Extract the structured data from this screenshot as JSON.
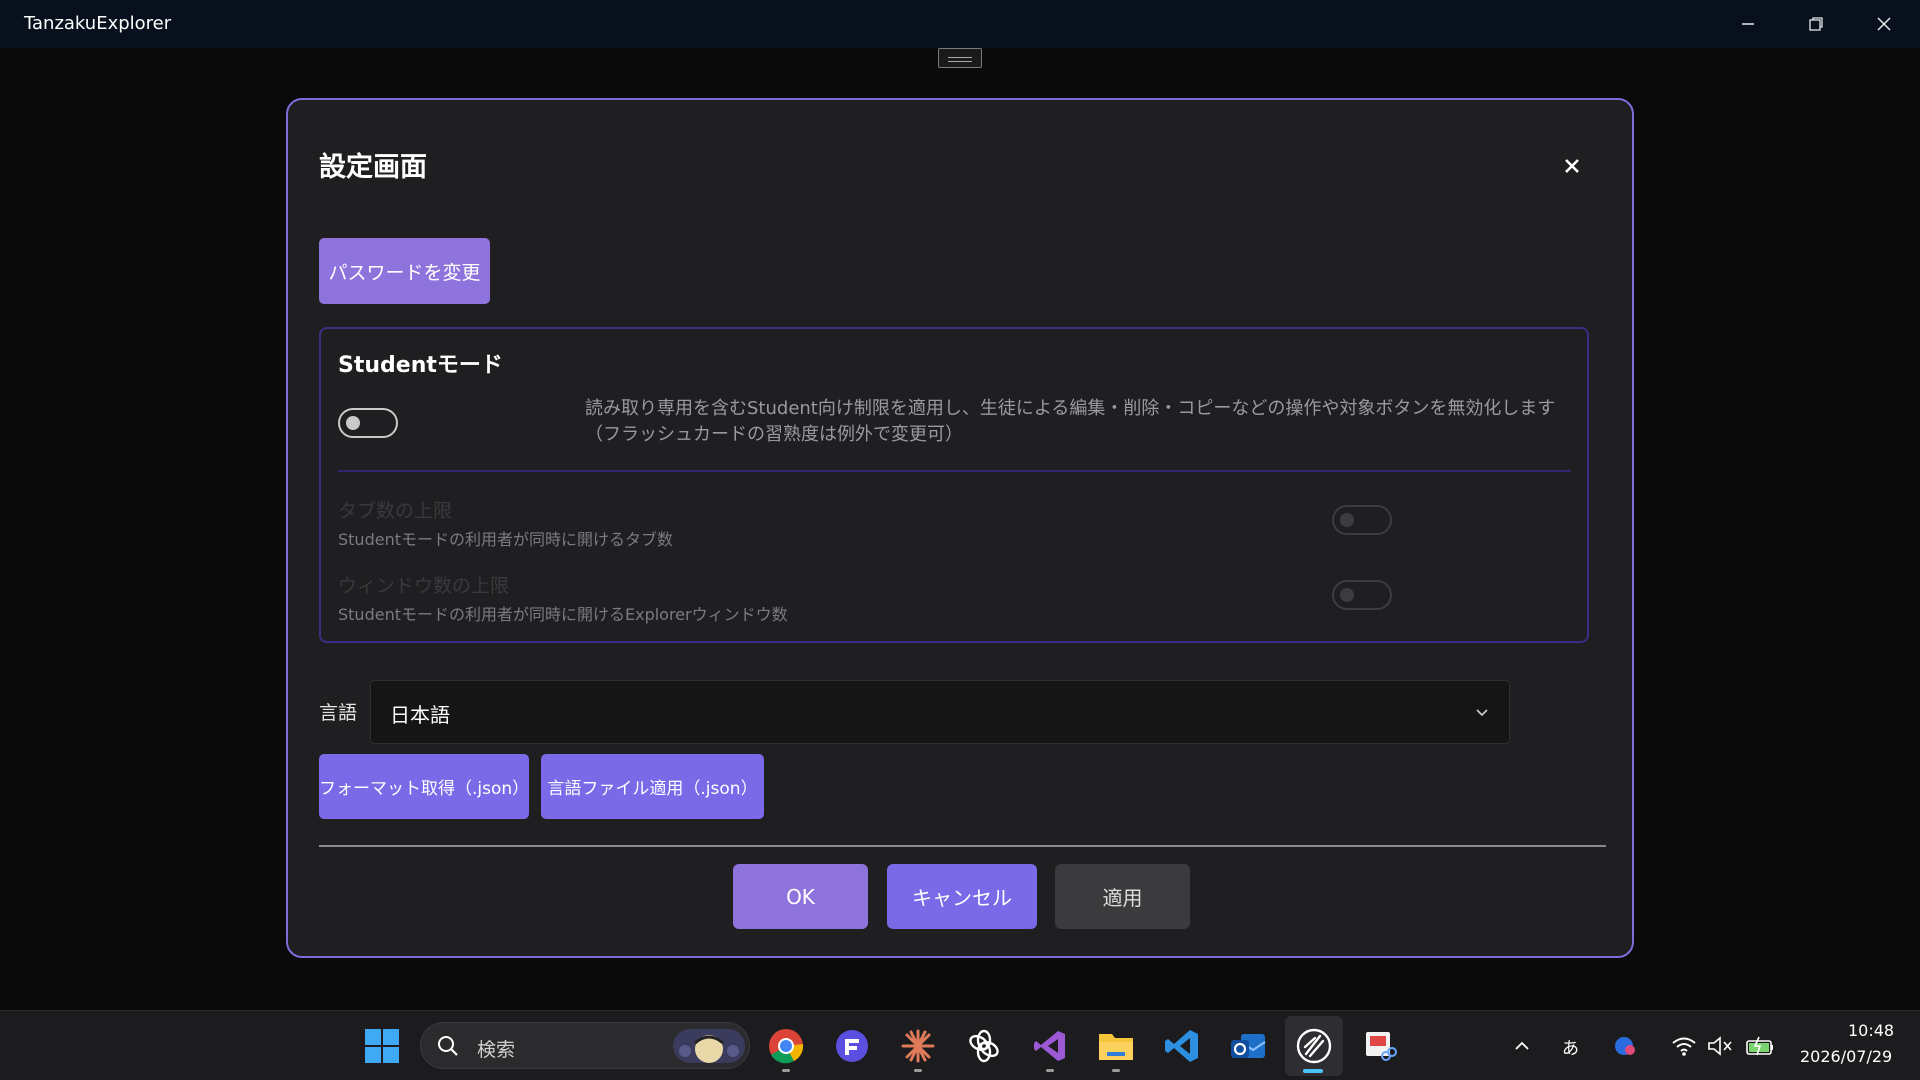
{
  "window": {
    "title": "TanzakuExplorer"
  },
  "dialog": {
    "title": "設定画面",
    "change_password_label": "パスワードを変更",
    "student": {
      "title": "Studentモード",
      "description": "読み取り専用を含むStudent向け制限を適用し、生徒による編集・削除・コピーなどの操作や対象ボタンを無効化します（フラッシュカードの習熟度は例外で変更可）",
      "enabled": false,
      "tab_limit_title": "タブ数の上限",
      "tab_limit_desc": "Studentモードの利用者が同時に開けるタブ数",
      "window_limit_title": "ウィンドウ数の上限",
      "window_limit_desc": "Studentモードの利用者が同時に開けるExplorerウィンドウ数"
    },
    "language": {
      "label": "言語",
      "selected": "日本語",
      "get_format_label": "フォーマット取得（.json）",
      "apply_file_label": "言語ファイル適用（.json）"
    },
    "footer": {
      "ok_label": "OK",
      "cancel_label": "キャンセル",
      "apply_label": "適用"
    }
  },
  "taskbar": {
    "search_placeholder": "検索",
    "apps": [
      "start-icon",
      "chrome-icon",
      "files-app-icon",
      "claude-icon",
      "chatgpt-icon",
      "visual-studio-icon",
      "file-explorer-icon",
      "vscode-icon",
      "outlook-icon",
      "tanzaku-explorer-icon",
      "snipping-tool-icon"
    ],
    "ime_label": "あ",
    "time": "10:48",
    "date": "2026/07/29"
  },
  "colors": {
    "accent_purple": "#8f73dc",
    "accent_blue": "#7b6ae8",
    "dialog_border": "#7d6dd8",
    "taskbar_active": "#4cc2ff"
  }
}
